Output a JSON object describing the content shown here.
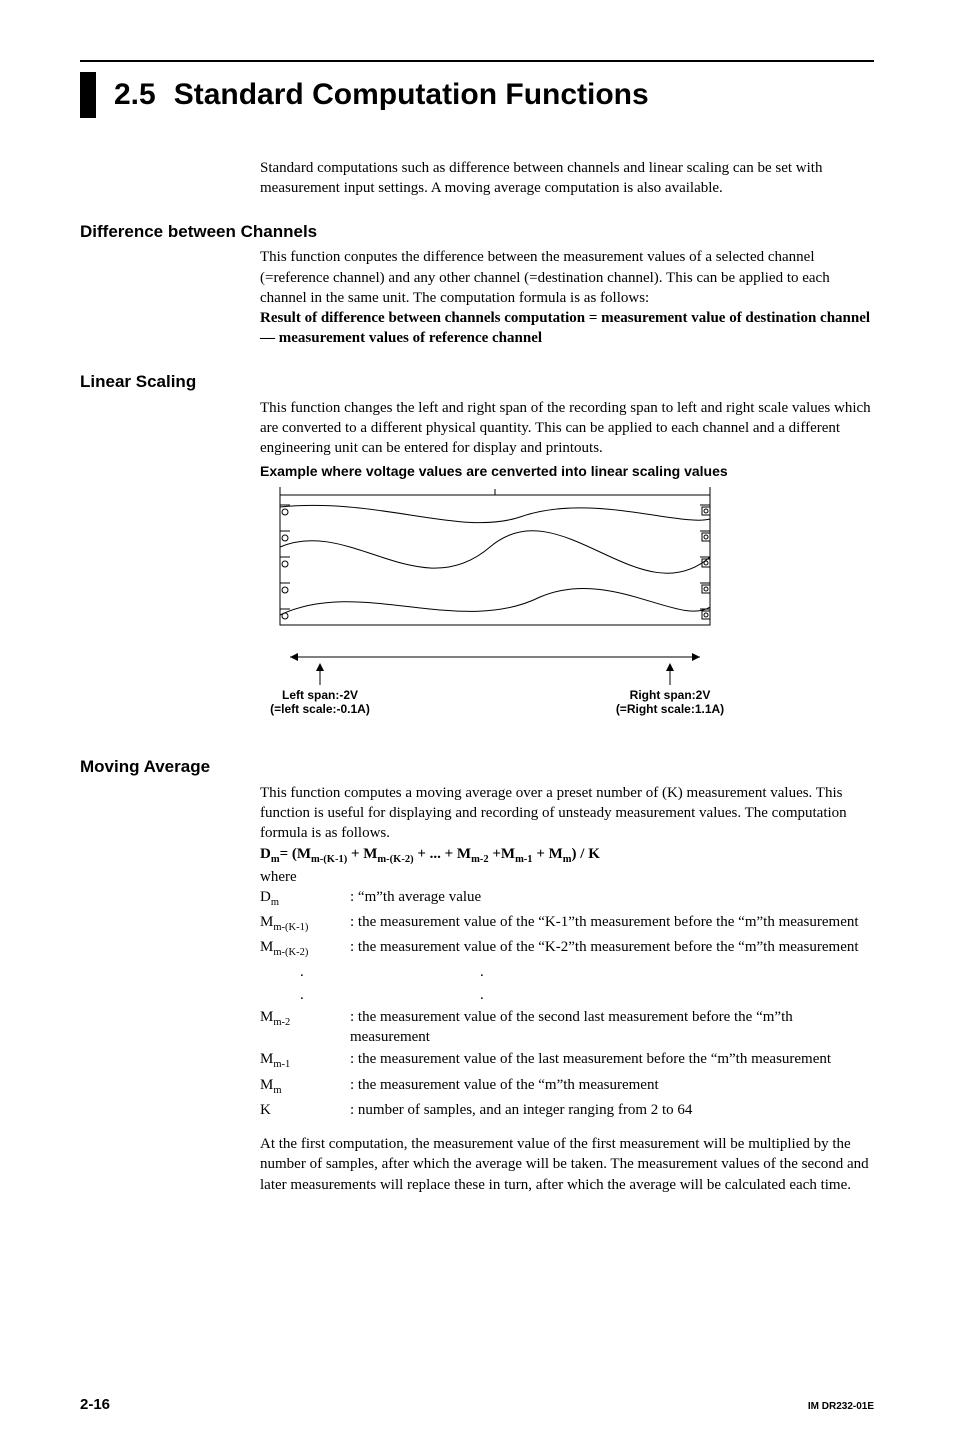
{
  "title": {
    "number": "2.5",
    "text": "Standard Computation Functions"
  },
  "intro": "Standard computations such as difference between channels and linear scaling can be set with measurement input settings. A moving average computation is also available.",
  "sections": {
    "diff": {
      "heading": "Difference between Channels",
      "body": "This function conputes the difference between the measurement values of a selected channel (=reference channel) and any other channel (=destination channel). This can be applied to each channel in the same unit.  The computation formula is as follows:",
      "formula": "Result of difference between channels computation = measurement value of destination channel — measurement values of reference channel"
    },
    "linear": {
      "heading": "Linear Scaling",
      "body": "This function changes the left and right span of the recording span to left and right scale values which are converted to a different physical quantity. This can be applied to each channel and a different engineering unit can be entered for display and printouts.",
      "example_caption": "Example where voltage values are cenverted into linear scaling values",
      "figure": {
        "left_span_label": "Left span:-2V",
        "left_scale_label": "(=left scale:-0.1A)",
        "right_span_label": "Right span:2V",
        "right_scale_label": "(=Right scale:1.1A)"
      }
    },
    "moving": {
      "heading": "Moving Average",
      "body": "This function computes a moving average over a preset number of (K) measurement values. This function is useful for displaying and recording of unsteady measurement values. The computation formula is as follows.",
      "formula_prefix": "D",
      "formula_sub": "m",
      "formula_rest": "= (M",
      "formula_full_html": "D<sub>m</sub>= (M<sub>m-(K-1)</sub> + M<sub>m-(K-2)</sub> + ... + M<sub>m-2</sub> +M<sub>m-1</sub> + M<sub>m</sub>) / K",
      "where": "where",
      "defs": [
        {
          "term_html": "D<sub>m</sub>",
          "desc": ": “m”th average value"
        },
        {
          "term_html": "M<sub>m-(K-1)</sub>",
          "desc": ": the measurement value of the “K-1”th measurement before the “m”th measurement"
        },
        {
          "term_html": "M<sub>m-(K-2)</sub>",
          "desc": ": the measurement value of the “K-2”th measurement before the “m”th measurement"
        }
      ],
      "dots": ".",
      "defs2": [
        {
          "term_html": "M<sub>m-2</sub>",
          "desc": ": the measurement value of the second last measurement before the “m”th measurement"
        },
        {
          "term_html": "M<sub>m-1</sub>",
          "desc": ": the measurement value of the last measurement before the “m”th measurement"
        },
        {
          "term_html": "M<sub>m</sub>",
          "desc": ": the measurement value of the “m”th measurement"
        },
        {
          "term_html": "K",
          "desc": ": number of samples, and an integer ranging from 2 to 64"
        }
      ],
      "trailer": "At the first computation, the measurement value of the first measurement will be multiplied by the number of samples, after which the average will be taken. The measurement values of the second and later measurements will replace these in turn, after which the average will be calculated each time."
    }
  },
  "footer": {
    "page": "2-16",
    "docid": "IM DR232-01E"
  }
}
